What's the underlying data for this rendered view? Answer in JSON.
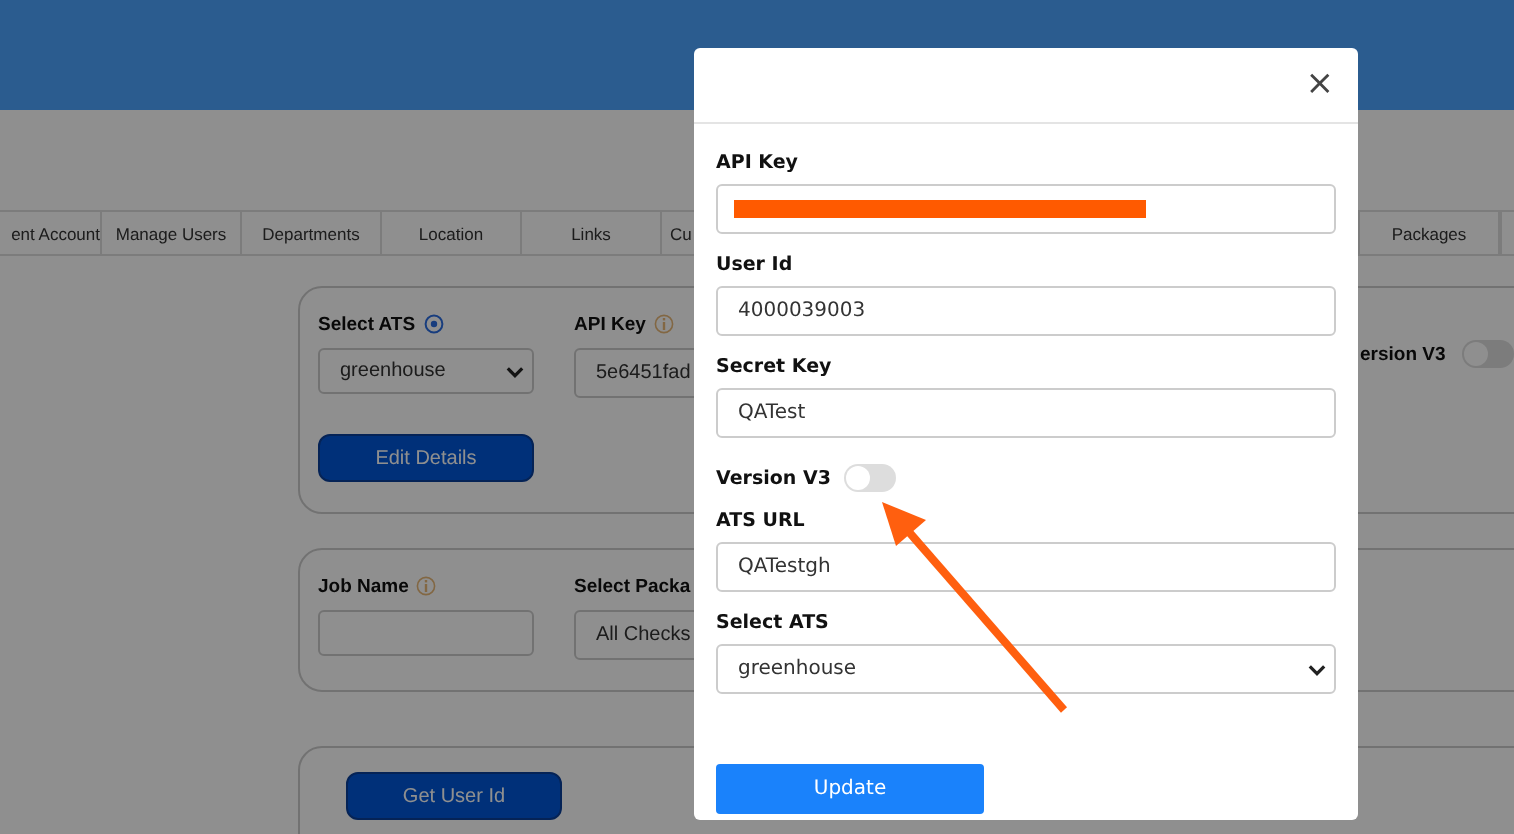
{
  "background_page": {
    "tabs_left": [
      "ent Account",
      "Manage Users",
      "Departments",
      "Location",
      "Links",
      "Cu"
    ],
    "tabs_right": [
      "Packages"
    ],
    "ats_card": {
      "select_label": "Select ATS",
      "select_value": "greenhouse",
      "api_key_label": "API Key",
      "api_key_value": "5e6451fad",
      "version_label": "ersion V3",
      "version_on": false,
      "edit_button": "Edit Details"
    },
    "job_card": {
      "job_name_label": "Job Name",
      "package_label": "Select Packa",
      "package_value": "All Checks"
    },
    "user_card": {
      "get_user_id_button": "Get User Id"
    }
  },
  "dialog": {
    "close": "×",
    "fields": [
      {
        "kind": "redacted",
        "label": "API Key"
      },
      {
        "kind": "text",
        "label": "User Id",
        "value": "4000039003"
      },
      {
        "kind": "text",
        "label": "Secret Key",
        "value": "QATest"
      },
      {
        "kind": "toggle",
        "label": "Version V3",
        "on": false
      },
      {
        "kind": "text",
        "label": "ATS URL",
        "value": "QATestgh"
      },
      {
        "kind": "select",
        "label": "Select ATS",
        "value": "greenhouse"
      }
    ],
    "submit_button": "Update"
  }
}
